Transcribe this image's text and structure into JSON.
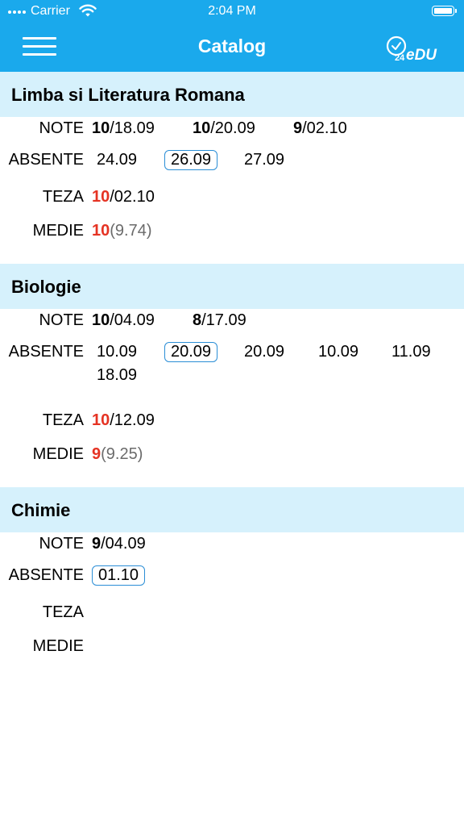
{
  "status_bar": {
    "carrier": "Carrier",
    "time": "2:04 PM"
  },
  "header": {
    "title": "Catalog",
    "logo_text": "eDU",
    "logo_number": "24"
  },
  "labels": {
    "note": "NOTE",
    "absente": "ABSENTE",
    "teza": "TEZA",
    "medie": "MEDIE"
  },
  "subjects": [
    {
      "name": "Limba si Literatura Romana",
      "grades": [
        {
          "grade": "10",
          "date": "/18.09"
        },
        {
          "grade": "10",
          "date": "/20.09"
        },
        {
          "grade": "9",
          "date": "/02.10"
        }
      ],
      "absences": [
        "24.09",
        "26.09",
        "27.09"
      ],
      "teza": {
        "grade": "10",
        "date": "/02.10"
      },
      "medie": {
        "grade": "10",
        "detail": "(9.74)"
      }
    },
    {
      "name": "Biologie",
      "grades": [
        {
          "grade": "10",
          "date": "/04.09"
        },
        {
          "grade": "8",
          "date": "/17.09"
        }
      ],
      "absences": [
        "10.09",
        "20.09",
        "20.09",
        "10.09",
        "11.09",
        "18.09"
      ],
      "teza": {
        "grade": "10",
        "date": "/12.09"
      },
      "medie": {
        "grade": "9",
        "detail": "(9.25)"
      }
    },
    {
      "name": "Chimie",
      "grades": [
        {
          "grade": "9",
          "date": "/04.09"
        }
      ],
      "absences": [
        "01.10"
      ]
    }
  ],
  "colors": {
    "accent": "#1aa9ec",
    "section_bg": "#d6f1fc",
    "teza_red": "#e53323",
    "box_blue": "#2b8ed6"
  }
}
